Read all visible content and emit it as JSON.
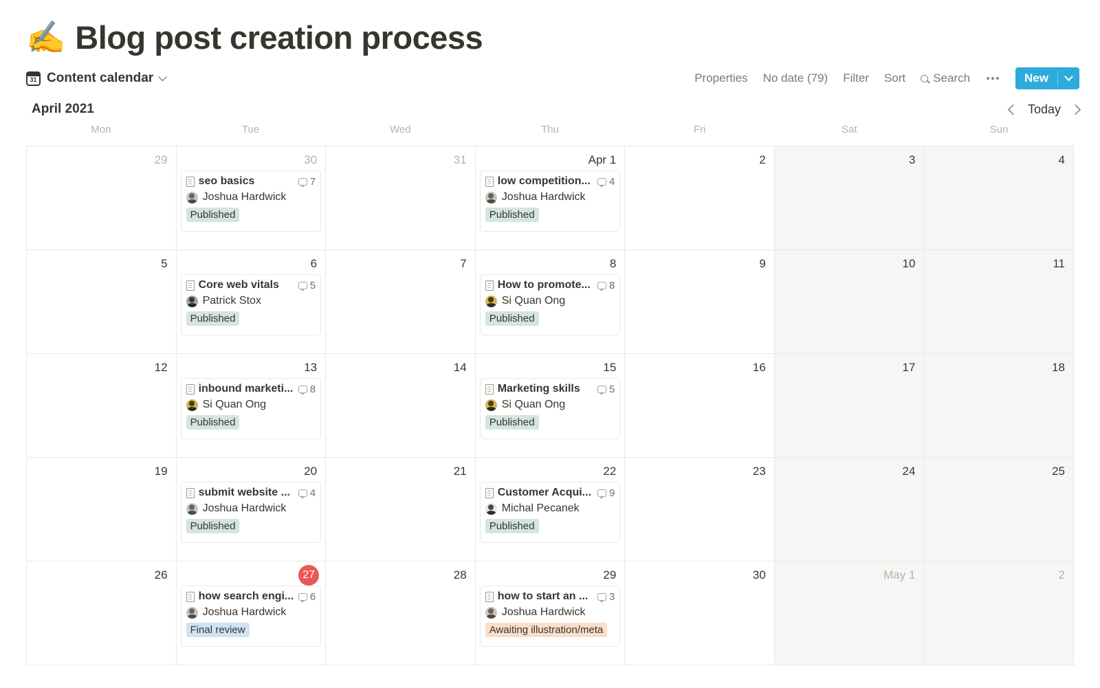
{
  "header": {
    "emoji": "✍️",
    "title": "Blog post creation process"
  },
  "toolbar": {
    "view_name": "Content calendar",
    "view_icon": "calendar-icon",
    "calendar_icon_day": "31",
    "properties_label": "Properties",
    "no_date_label": "No date (79)",
    "filter_label": "Filter",
    "sort_label": "Sort",
    "search_label": "Search",
    "more_label": "...",
    "new_label": "New"
  },
  "month_bar": {
    "month_label": "April 2021",
    "today_label": "Today",
    "prev_icon": "chevron-left-icon",
    "next_icon": "chevron-right-icon"
  },
  "weekdays": [
    "Mon",
    "Tue",
    "Wed",
    "Thu",
    "Fri",
    "Sat",
    "Sun"
  ],
  "colors": {
    "accent_blue": "#2eaadc",
    "today_red": "#eb5757",
    "published_green": "#d3e5df",
    "final_review_blue": "#cfe3f5",
    "awaiting_orange": "#fbdec8",
    "weekend_bg": "#f7f6f4",
    "grid_line": "#eae9e6"
  },
  "weeks": [
    {
      "days": [
        {
          "num": "29",
          "muted": true,
          "weekend": false,
          "today": false,
          "events": []
        },
        {
          "num": "30",
          "muted": true,
          "weekend": false,
          "today": false,
          "events": [
            {
              "title": "seo basics",
              "comments": "7",
              "author": "Joshua Hardwick",
              "avatar": "a-hardwick",
              "status": "Published",
              "status_class": "published"
            }
          ]
        },
        {
          "num": "31",
          "muted": true,
          "weekend": false,
          "today": false,
          "events": []
        },
        {
          "num": "Apr 1",
          "muted": false,
          "weekend": false,
          "today": false,
          "events": [
            {
              "title": "low competition...",
              "comments": "4",
              "author": "Joshua Hardwick",
              "avatar": "a-hardwick",
              "status": "Published",
              "status_class": "published"
            }
          ]
        },
        {
          "num": "2",
          "muted": false,
          "weekend": false,
          "today": false,
          "events": []
        },
        {
          "num": "3",
          "muted": false,
          "weekend": true,
          "today": false,
          "events": []
        },
        {
          "num": "4",
          "muted": false,
          "weekend": true,
          "today": false,
          "events": []
        }
      ]
    },
    {
      "days": [
        {
          "num": "5",
          "muted": false,
          "weekend": false,
          "today": false,
          "events": []
        },
        {
          "num": "6",
          "muted": false,
          "weekend": false,
          "today": false,
          "events": [
            {
              "title": "Core web vitals",
              "comments": "5",
              "author": "Patrick Stox",
              "avatar": "a-stox",
              "status": "Published",
              "status_class": "published"
            }
          ]
        },
        {
          "num": "7",
          "muted": false,
          "weekend": false,
          "today": false,
          "events": []
        },
        {
          "num": "8",
          "muted": false,
          "weekend": false,
          "today": false,
          "events": [
            {
              "title": "How to promote...",
              "comments": "8",
              "author": "Si Quan Ong",
              "avatar": "a-ong",
              "status": "Published",
              "status_class": "published"
            }
          ]
        },
        {
          "num": "9",
          "muted": false,
          "weekend": false,
          "today": false,
          "events": []
        },
        {
          "num": "10",
          "muted": false,
          "weekend": true,
          "today": false,
          "events": []
        },
        {
          "num": "11",
          "muted": false,
          "weekend": true,
          "today": false,
          "events": []
        }
      ]
    },
    {
      "days": [
        {
          "num": "12",
          "muted": false,
          "weekend": false,
          "today": false,
          "events": []
        },
        {
          "num": "13",
          "muted": false,
          "weekend": false,
          "today": false,
          "events": [
            {
              "title": "inbound marketi...",
              "comments": "8",
              "author": "Si Quan Ong",
              "avatar": "a-ong",
              "status": "Published",
              "status_class": "published"
            }
          ]
        },
        {
          "num": "14",
          "muted": false,
          "weekend": false,
          "today": false,
          "events": []
        },
        {
          "num": "15",
          "muted": false,
          "weekend": false,
          "today": false,
          "events": [
            {
              "title": "Marketing skills",
              "comments": "5",
              "author": "Si Quan Ong",
              "avatar": "a-ong",
              "status": "Published",
              "status_class": "published"
            }
          ]
        },
        {
          "num": "16",
          "muted": false,
          "weekend": false,
          "today": false,
          "events": []
        },
        {
          "num": "17",
          "muted": false,
          "weekend": true,
          "today": false,
          "events": []
        },
        {
          "num": "18",
          "muted": false,
          "weekend": true,
          "today": false,
          "events": []
        }
      ]
    },
    {
      "days": [
        {
          "num": "19",
          "muted": false,
          "weekend": false,
          "today": false,
          "events": []
        },
        {
          "num": "20",
          "muted": false,
          "weekend": false,
          "today": false,
          "events": [
            {
              "title": "submit website ...",
              "comments": "4",
              "author": "Joshua Hardwick",
              "avatar": "a-hardwick",
              "status": "Published",
              "status_class": "published"
            }
          ]
        },
        {
          "num": "21",
          "muted": false,
          "weekend": false,
          "today": false,
          "events": []
        },
        {
          "num": "22",
          "muted": false,
          "weekend": false,
          "today": false,
          "events": [
            {
              "title": "Customer Acqui...",
              "comments": "9",
              "author": "Michal Pecanek",
              "avatar": "a-pecanek",
              "status": "Published",
              "status_class": "published"
            }
          ]
        },
        {
          "num": "23",
          "muted": false,
          "weekend": false,
          "today": false,
          "events": []
        },
        {
          "num": "24",
          "muted": false,
          "weekend": true,
          "today": false,
          "events": []
        },
        {
          "num": "25",
          "muted": false,
          "weekend": true,
          "today": false,
          "events": []
        }
      ]
    },
    {
      "days": [
        {
          "num": "26",
          "muted": false,
          "weekend": false,
          "today": false,
          "events": []
        },
        {
          "num": "27",
          "muted": false,
          "weekend": false,
          "today": true,
          "events": [
            {
              "title": "how search engi...",
              "comments": "6",
              "author": "Joshua Hardwick",
              "avatar": "a-hardwick",
              "status": "Final review",
              "status_class": "final-review"
            }
          ]
        },
        {
          "num": "28",
          "muted": false,
          "weekend": false,
          "today": false,
          "events": []
        },
        {
          "num": "29",
          "muted": false,
          "weekend": false,
          "today": false,
          "events": [
            {
              "title": "how to start an ...",
              "comments": "3",
              "author": "Joshua Hardwick",
              "avatar": "a-hardwick",
              "status": "Awaiting illustration/meta",
              "status_class": "awaiting"
            }
          ]
        },
        {
          "num": "30",
          "muted": false,
          "weekend": false,
          "today": false,
          "events": []
        },
        {
          "num": "May 1",
          "muted": true,
          "weekend": true,
          "today": false,
          "events": []
        },
        {
          "num": "2",
          "muted": true,
          "weekend": true,
          "today": false,
          "events": []
        }
      ]
    }
  ]
}
